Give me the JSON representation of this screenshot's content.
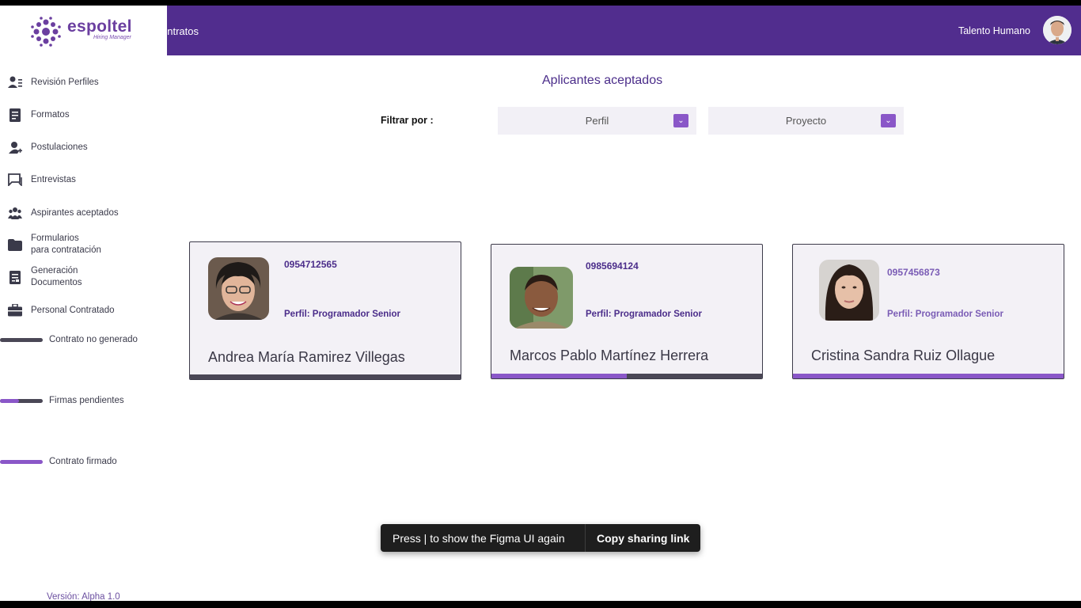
{
  "topbar": {
    "crumb": "ontratos",
    "user_label": "Talento Humano"
  },
  "brand": {
    "name": "espoltel",
    "tagline": "Hiring Manager"
  },
  "sidebar": {
    "items": [
      {
        "label": "Revisión Perfiles",
        "icon": "user-list-icon"
      },
      {
        "label": "Formatos",
        "icon": "document-icon"
      },
      {
        "label": "Postulaciones",
        "icon": "user-add-icon"
      },
      {
        "label": "Entrevistas",
        "icon": "chat-icon"
      },
      {
        "label": "Aspirantes aceptados",
        "icon": "group-icon"
      },
      {
        "label": "Formularios\npara contratación",
        "icon": "folder-icon"
      },
      {
        "label": "Generación\nDocumentos",
        "icon": "document-edit-icon"
      },
      {
        "label": "Personal Contratado",
        "icon": "briefcase-icon"
      }
    ],
    "legend": [
      {
        "label": "Contrato no generado"
      },
      {
        "label": "Firmas pendientes"
      },
      {
        "label": "Contrato firmado"
      }
    ],
    "version": "Versión: Alpha 1.0"
  },
  "main": {
    "title": "Aplicantes aceptados",
    "filter_label": "Filtrar por :",
    "filters": [
      {
        "label": "Perfil"
      },
      {
        "label": "Proyecto"
      }
    ]
  },
  "cards": [
    {
      "phone": "0954712565",
      "perfil": "Perfil: Programador Senior",
      "name": "Andrea María Ramirez Villegas",
      "status": "Contrato no generado"
    },
    {
      "phone": "0985694124",
      "perfil": "Perfil: Programador Senior",
      "name": "Marcos Pablo Martínez Herrera",
      "status": "Firmas pendientes"
    },
    {
      "phone": "0957456873",
      "perfil": "Perfil: Programador Senior",
      "name": "Cristina Sandra Ruiz Ollague",
      "status": "Contrato firmado"
    }
  ],
  "toast": {
    "message": "Press | to show the Figma UI again",
    "link": "Copy sharing link"
  },
  "colors": {
    "primary": "#512d8e",
    "accent": "#8a57c8",
    "dark": "#4a4756"
  }
}
